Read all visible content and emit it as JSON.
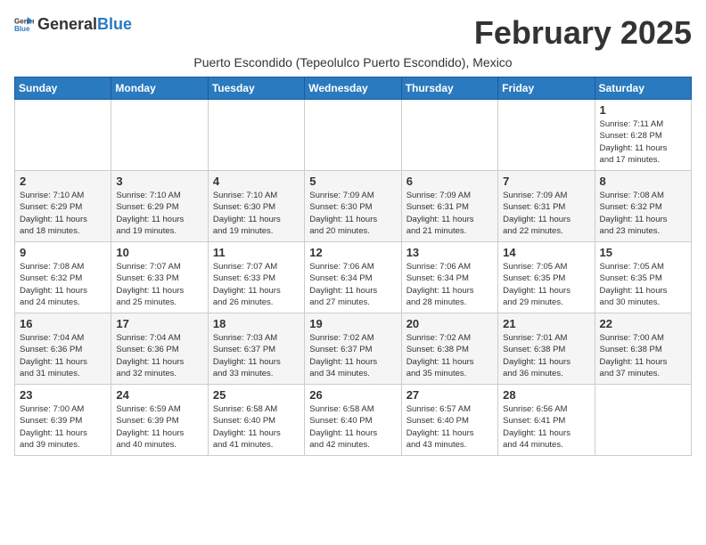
{
  "header": {
    "logo_general": "General",
    "logo_blue": "Blue",
    "title": "February 2025",
    "subtitle": "Puerto Escondido (Tepeolulco Puerto Escondido), Mexico"
  },
  "weekdays": [
    "Sunday",
    "Monday",
    "Tuesday",
    "Wednesday",
    "Thursday",
    "Friday",
    "Saturday"
  ],
  "weeks": [
    [
      {
        "day": "",
        "info": ""
      },
      {
        "day": "",
        "info": ""
      },
      {
        "day": "",
        "info": ""
      },
      {
        "day": "",
        "info": ""
      },
      {
        "day": "",
        "info": ""
      },
      {
        "day": "",
        "info": ""
      },
      {
        "day": "1",
        "info": "Sunrise: 7:11 AM\nSunset: 6:28 PM\nDaylight: 11 hours\nand 17 minutes."
      }
    ],
    [
      {
        "day": "2",
        "info": "Sunrise: 7:10 AM\nSunset: 6:29 PM\nDaylight: 11 hours\nand 18 minutes."
      },
      {
        "day": "3",
        "info": "Sunrise: 7:10 AM\nSunset: 6:29 PM\nDaylight: 11 hours\nand 19 minutes."
      },
      {
        "day": "4",
        "info": "Sunrise: 7:10 AM\nSunset: 6:30 PM\nDaylight: 11 hours\nand 19 minutes."
      },
      {
        "day": "5",
        "info": "Sunrise: 7:09 AM\nSunset: 6:30 PM\nDaylight: 11 hours\nand 20 minutes."
      },
      {
        "day": "6",
        "info": "Sunrise: 7:09 AM\nSunset: 6:31 PM\nDaylight: 11 hours\nand 21 minutes."
      },
      {
        "day": "7",
        "info": "Sunrise: 7:09 AM\nSunset: 6:31 PM\nDaylight: 11 hours\nand 22 minutes."
      },
      {
        "day": "8",
        "info": "Sunrise: 7:08 AM\nSunset: 6:32 PM\nDaylight: 11 hours\nand 23 minutes."
      }
    ],
    [
      {
        "day": "9",
        "info": "Sunrise: 7:08 AM\nSunset: 6:32 PM\nDaylight: 11 hours\nand 24 minutes."
      },
      {
        "day": "10",
        "info": "Sunrise: 7:07 AM\nSunset: 6:33 PM\nDaylight: 11 hours\nand 25 minutes."
      },
      {
        "day": "11",
        "info": "Sunrise: 7:07 AM\nSunset: 6:33 PM\nDaylight: 11 hours\nand 26 minutes."
      },
      {
        "day": "12",
        "info": "Sunrise: 7:06 AM\nSunset: 6:34 PM\nDaylight: 11 hours\nand 27 minutes."
      },
      {
        "day": "13",
        "info": "Sunrise: 7:06 AM\nSunset: 6:34 PM\nDaylight: 11 hours\nand 28 minutes."
      },
      {
        "day": "14",
        "info": "Sunrise: 7:05 AM\nSunset: 6:35 PM\nDaylight: 11 hours\nand 29 minutes."
      },
      {
        "day": "15",
        "info": "Sunrise: 7:05 AM\nSunset: 6:35 PM\nDaylight: 11 hours\nand 30 minutes."
      }
    ],
    [
      {
        "day": "16",
        "info": "Sunrise: 7:04 AM\nSunset: 6:36 PM\nDaylight: 11 hours\nand 31 minutes."
      },
      {
        "day": "17",
        "info": "Sunrise: 7:04 AM\nSunset: 6:36 PM\nDaylight: 11 hours\nand 32 minutes."
      },
      {
        "day": "18",
        "info": "Sunrise: 7:03 AM\nSunset: 6:37 PM\nDaylight: 11 hours\nand 33 minutes."
      },
      {
        "day": "19",
        "info": "Sunrise: 7:02 AM\nSunset: 6:37 PM\nDaylight: 11 hours\nand 34 minutes."
      },
      {
        "day": "20",
        "info": "Sunrise: 7:02 AM\nSunset: 6:38 PM\nDaylight: 11 hours\nand 35 minutes."
      },
      {
        "day": "21",
        "info": "Sunrise: 7:01 AM\nSunset: 6:38 PM\nDaylight: 11 hours\nand 36 minutes."
      },
      {
        "day": "22",
        "info": "Sunrise: 7:00 AM\nSunset: 6:38 PM\nDaylight: 11 hours\nand 37 minutes."
      }
    ],
    [
      {
        "day": "23",
        "info": "Sunrise: 7:00 AM\nSunset: 6:39 PM\nDaylight: 11 hours\nand 39 minutes."
      },
      {
        "day": "24",
        "info": "Sunrise: 6:59 AM\nSunset: 6:39 PM\nDaylight: 11 hours\nand 40 minutes."
      },
      {
        "day": "25",
        "info": "Sunrise: 6:58 AM\nSunset: 6:40 PM\nDaylight: 11 hours\nand 41 minutes."
      },
      {
        "day": "26",
        "info": "Sunrise: 6:58 AM\nSunset: 6:40 PM\nDaylight: 11 hours\nand 42 minutes."
      },
      {
        "day": "27",
        "info": "Sunrise: 6:57 AM\nSunset: 6:40 PM\nDaylight: 11 hours\nand 43 minutes."
      },
      {
        "day": "28",
        "info": "Sunrise: 6:56 AM\nSunset: 6:41 PM\nDaylight: 11 hours\nand 44 minutes."
      },
      {
        "day": "",
        "info": ""
      }
    ]
  ]
}
